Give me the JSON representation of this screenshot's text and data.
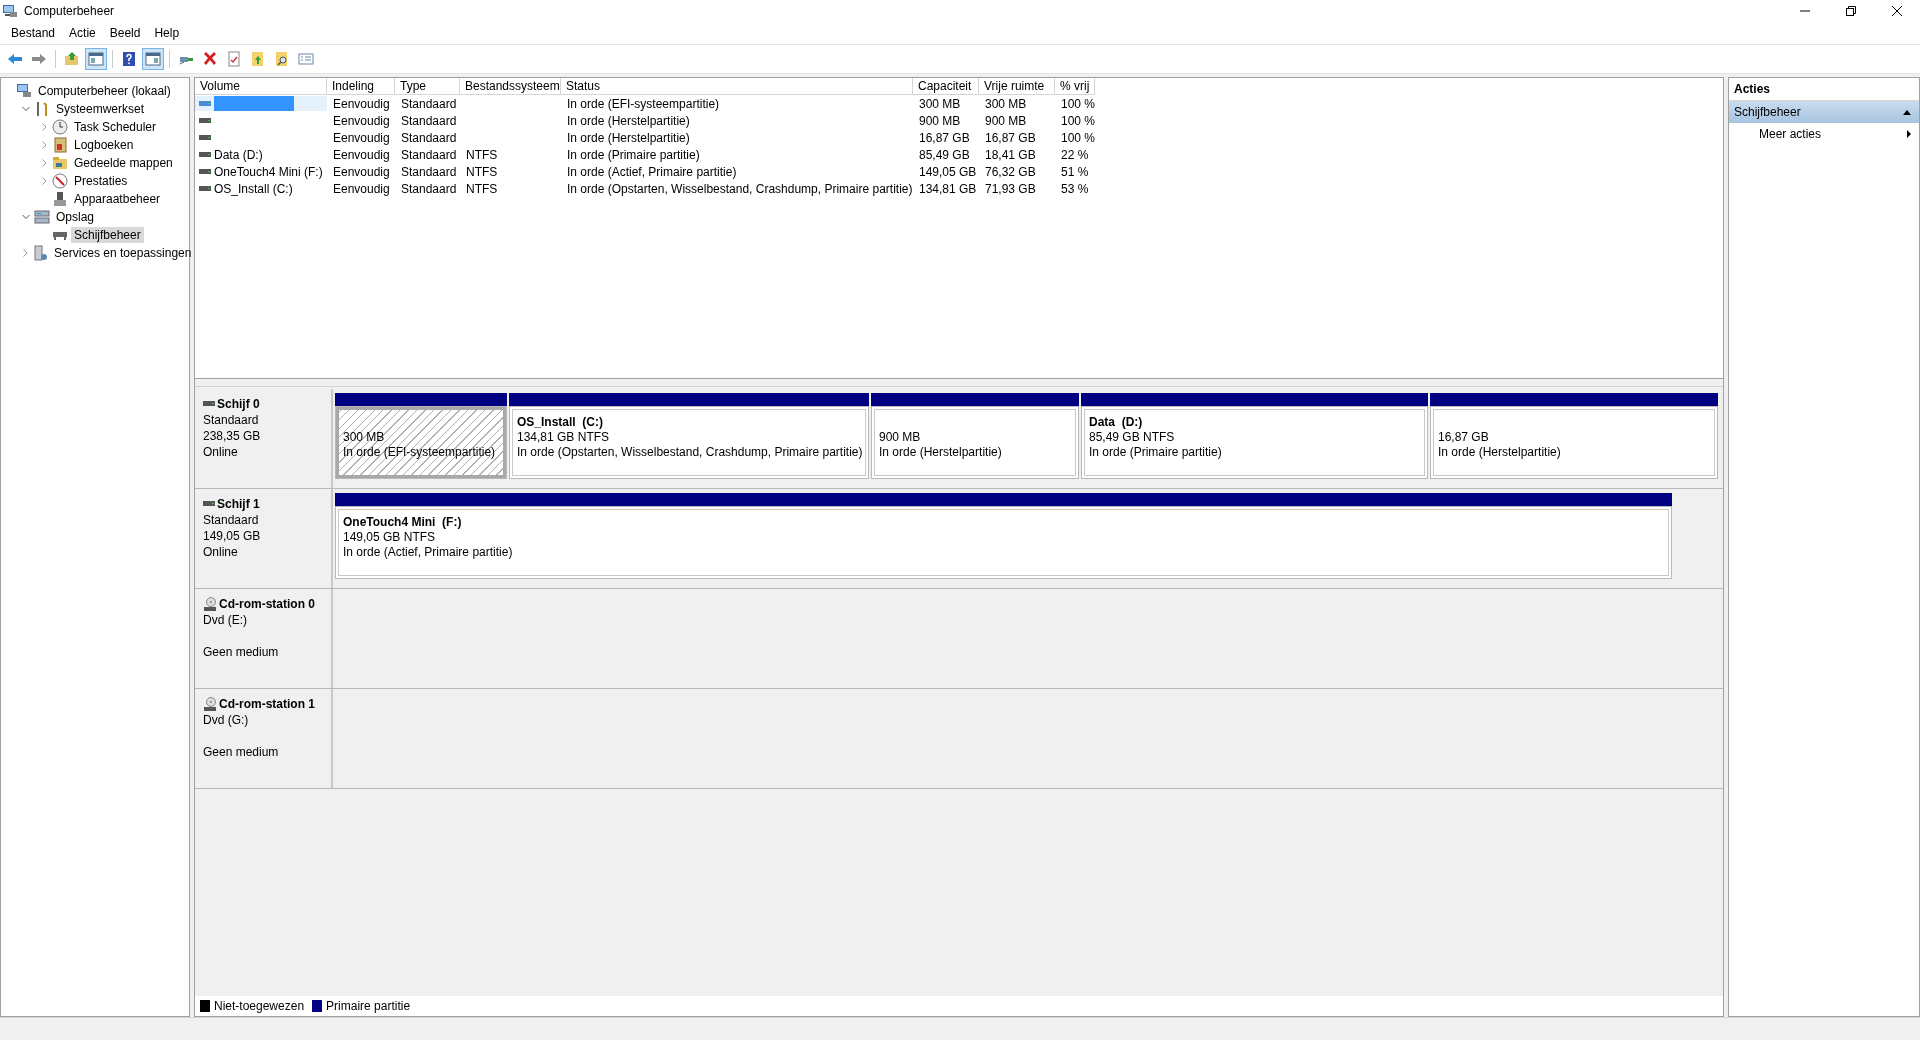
{
  "window": {
    "title": "Computerbeheer"
  },
  "menu": [
    "Bestand",
    "Actie",
    "Beeld",
    "Help"
  ],
  "toolbar": [
    [
      {
        "kind": "back",
        "on": false
      },
      {
        "kind": "forward",
        "on": false
      }
    ],
    [
      {
        "kind": "up",
        "on": false
      },
      {
        "kind": "pane-left",
        "on": true
      }
    ],
    [
      {
        "kind": "help",
        "on": false
      },
      {
        "kind": "pane-right",
        "on": true
      }
    ],
    [
      {
        "kind": "connect",
        "on": false
      },
      {
        "kind": "delete",
        "on": false
      },
      {
        "kind": "properties",
        "on": false
      },
      {
        "kind": "export",
        "on": false
      },
      {
        "kind": "find",
        "on": false
      },
      {
        "kind": "list",
        "on": false
      }
    ]
  ],
  "tree": [
    {
      "label": "Computerbeheer (lokaal)",
      "kind": "computer",
      "selected": false,
      "children": [
        {
          "label": "Systeemwerkset",
          "kind": "tools",
          "expanded": true,
          "selected": false,
          "children": [
            {
              "label": "Task Scheduler",
              "kind": "clock",
              "expanded": false,
              "selected": false
            },
            {
              "label": "Logboeken",
              "kind": "log",
              "expanded": false,
              "selected": false
            },
            {
              "label": "Gedeelde mappen",
              "kind": "folder",
              "expanded": false,
              "selected": false
            },
            {
              "label": "Prestaties",
              "kind": "gauge",
              "expanded": false,
              "selected": false
            },
            {
              "label": "Apparaatbeheer",
              "kind": "device",
              "selected": false
            }
          ]
        },
        {
          "label": "Opslag",
          "kind": "storage",
          "expanded": true,
          "selected": false,
          "children": [
            {
              "label": "Schijfbeheer",
              "kind": "drive",
              "selected": true
            }
          ]
        },
        {
          "label": "Services en toepassingen",
          "kind": "services",
          "expanded": false,
          "selected": false
        }
      ]
    }
  ],
  "table": {
    "columns": [
      "Volume",
      "Indeling",
      "Type",
      "Bestandssysteem",
      "Status",
      "Capaciteit",
      "Vrije ruimte",
      "% vrij"
    ],
    "rows": [
      {
        "selected": true,
        "layout": "Eenvoudig",
        "type": "Standaard",
        "status": "In orde (EFI-systeempartitie)",
        "capacity": "300 MB",
        "free": "300 MB",
        "pct_free": "100 %"
      },
      {
        "selected": false,
        "layout": "Eenvoudig",
        "type": "Standaard",
        "status": "In orde (Herstelpartitie)",
        "capacity": "900 MB",
        "free": "900 MB",
        "pct_free": "100 %"
      },
      {
        "selected": false,
        "layout": "Eenvoudig",
        "type": "Standaard",
        "status": "In orde (Herstelpartitie)",
        "capacity": "16,87 GB",
        "free": "16,87 GB",
        "pct_free": "100 %"
      },
      {
        "volume": "Data (D:)",
        "selected": false,
        "layout": "Eenvoudig",
        "type": "Standaard",
        "fs": "NTFS",
        "status": "In orde (Primaire partitie)",
        "capacity": "85,49 GB",
        "free": "18,41 GB",
        "pct_free": "22 %"
      },
      {
        "volume": "OneTouch4 Mini (F:)",
        "selected": false,
        "layout": "Eenvoudig",
        "type": "Standaard",
        "fs": "NTFS",
        "status": "In orde (Actief, Primaire partitie)",
        "capacity": "149,05 GB",
        "free": "76,32 GB",
        "pct_free": "51 %"
      },
      {
        "volume": "OS_Install (C:)",
        "selected": false,
        "layout": "Eenvoudig",
        "type": "Standaard",
        "fs": "NTFS",
        "status": "In orde (Opstarten, Wisselbestand, Crashdump, Primaire partitie)",
        "capacity": "134,81 GB",
        "free": "71,93 GB",
        "pct_free": "53 %"
      }
    ]
  },
  "disks": [
    {
      "name": "Schijf 0",
      "kind": "disk",
      "type": "Standaard",
      "size": "238,35 GB",
      "status": "Online",
      "partitions": [
        {
          "size": "300 MB",
          "status": "In orde (EFI-systeempartitie)",
          "selected": true
        },
        {
          "name": "OS_Install  (C:)",
          "size": "134,81 GB NTFS",
          "status": "In orde (Opstarten, Wisselbestand, Crashdump, Primaire partitie)",
          "selected": false
        },
        {
          "size": "900 MB",
          "status": "In orde (Herstelpartitie)",
          "selected": false
        },
        {
          "name": "Data  (D:)",
          "size": "85,49 GB NTFS",
          "status": "In orde (Primaire partitie)",
          "selected": false
        },
        {
          "size": "16,87 GB",
          "status": "In orde (Herstelpartitie)",
          "selected": false
        }
      ]
    },
    {
      "name": "Schijf 1",
      "kind": "disk",
      "type": "Standaard",
      "size": "149,05 GB",
      "status": "Online",
      "partitions": [
        {
          "name": "OneTouch4 Mini  (F:)",
          "size": "149,05 GB NTFS",
          "status": "In orde (Actief, Primaire partitie)",
          "selected": false
        }
      ]
    },
    {
      "name": "Cd-rom-station 0",
      "kind": "cdrom",
      "type": "Dvd (E:)",
      "status": "Geen medium"
    },
    {
      "name": "Cd-rom-station 1",
      "kind": "cdrom",
      "type": "Dvd (G:)",
      "status": "Geen medium"
    }
  ],
  "legend": [
    {
      "label": "Niet-toegewezen",
      "color": "#000000"
    },
    {
      "label": "Primaire partitie",
      "color": "#000080"
    }
  ],
  "actions": {
    "title": "Acties",
    "section": {
      "label": "Schijfbeheer",
      "expanded": true
    },
    "items": [
      {
        "label": "Meer acties"
      }
    ]
  }
}
